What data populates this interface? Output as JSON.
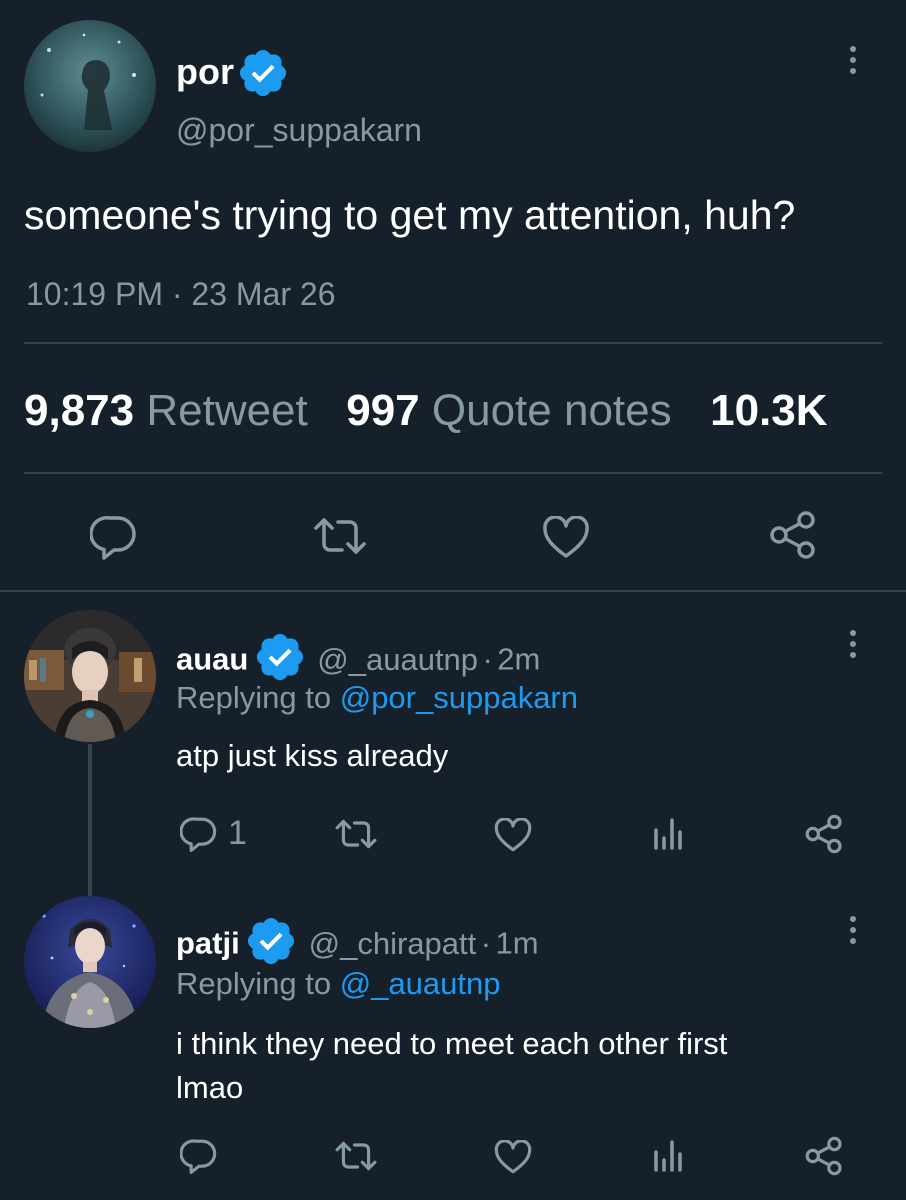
{
  "main_tweet": {
    "display_name": "por",
    "handle": "@por_suppakarn",
    "text": "someone's trying to get my attention, huh?",
    "time": "10:19 PM",
    "separator": "·",
    "date": "23 Mar 26",
    "stats": [
      {
        "count": "9,873",
        "label": "Retweet"
      },
      {
        "count": "997",
        "label": "Quote notes"
      },
      {
        "count": "10.3K",
        "label": ""
      }
    ]
  },
  "replies": [
    {
      "display_name": "auau",
      "handle": "@_auautnp",
      "time_sep": "·",
      "time": "2m",
      "replying_label": "Replying to",
      "replying_to": "@por_suppakarn",
      "text": "atp just kiss already",
      "reply_count": "1"
    },
    {
      "display_name": "patji",
      "handle": "@_chirapatt",
      "time_sep": "·",
      "time": "1m",
      "replying_label": "Replying to",
      "replying_to": "@_auautnp",
      "text_line1": "i think they need to meet each other first",
      "text_line2": "lmao"
    }
  ],
  "colors": {
    "background": "#15202b",
    "muted": "#8899a6",
    "link": "#1d9bf0",
    "divider": "#38444d",
    "verified": "#1d9bf0"
  },
  "icons": [
    "reply-icon",
    "retweet-icon",
    "like-icon",
    "share-icon",
    "analytics-icon",
    "more-icon",
    "verified-icon"
  ]
}
